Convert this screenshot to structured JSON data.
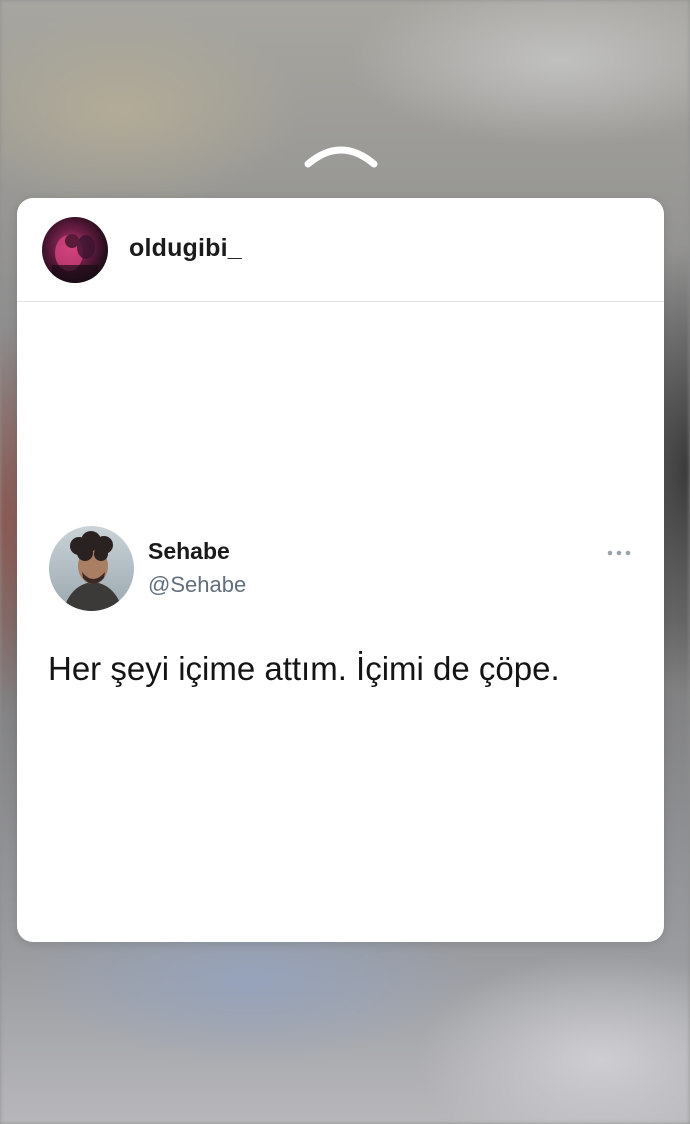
{
  "app": {
    "gesture_hint_icon": "chevron-up-icon"
  },
  "post": {
    "username": "oldugibi_",
    "avatar_icon": "profile-avatar"
  },
  "tweet": {
    "display_name": "Sehabe",
    "handle": "@Sehabe",
    "text": "Her şeyi içime attım. İçimi de çöpe.",
    "avatar_icon": "profile-avatar",
    "more_icon": "more-options-icon"
  },
  "colors": {
    "card_background": "#ffffff",
    "handle_gray": "#62707d",
    "divider": "#e3e3e3"
  }
}
